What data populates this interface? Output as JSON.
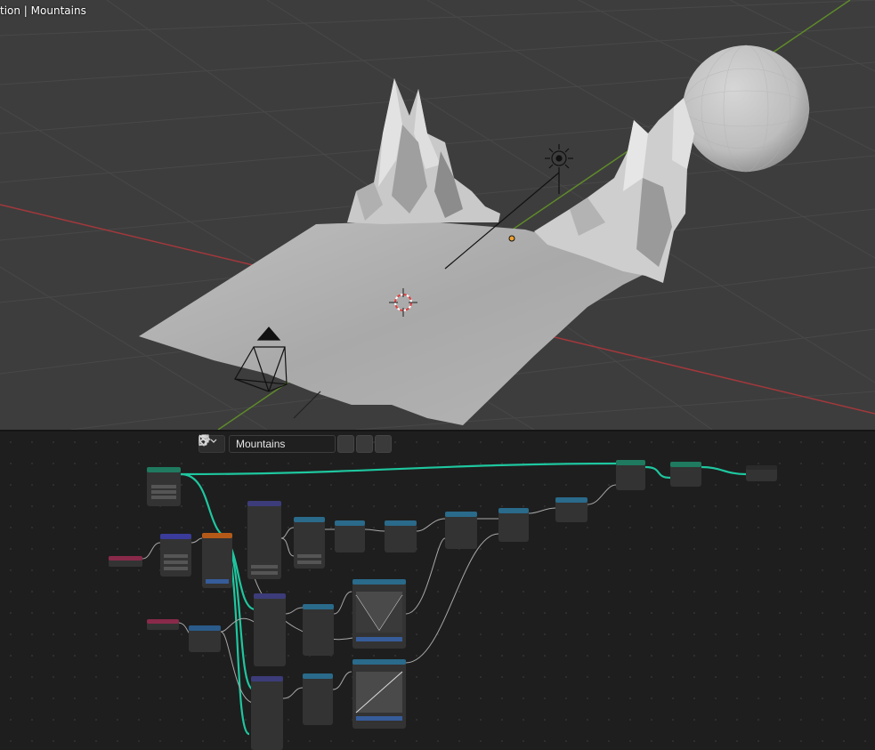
{
  "viewport": {
    "title": "tion | Mountains"
  },
  "node_editor": {
    "node_group_name": "Mountains",
    "icons": {
      "editor_type": "node-tree-icon",
      "fake_user": "shield-icon",
      "duplicate": "copy-icon",
      "unlink": "close-icon",
      "pin": "pin-icon"
    }
  },
  "colors": {
    "viewport_bg": "#3d3d3d",
    "editor_bg": "#1e1e1e",
    "geometry_link": "#1ec79f",
    "x_axis": "#a3383c",
    "y_axis": "#5f8a2a"
  }
}
